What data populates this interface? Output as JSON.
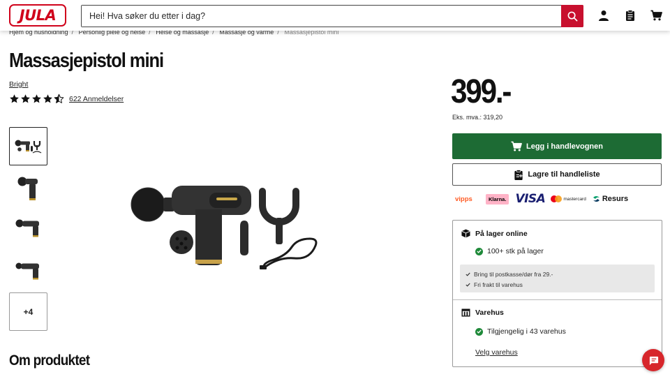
{
  "header": {
    "logo_text": "JULA",
    "search_placeholder": "Hei! Hva søker du etter i dag?",
    "icons": [
      "search-icon",
      "user-icon",
      "clipboard-list-icon",
      "shopping-cart-icon"
    ]
  },
  "breadcrumb": [
    "Hjem og husholdning",
    "Personlig pleie og helse",
    "Helse og massasje",
    "Massasje og varme",
    "Massasjepistol mini"
  ],
  "product": {
    "title": "Massasjepistol mini",
    "brand": "Bright",
    "rating": 4.5,
    "reviews_label": "622 Anmeldelser",
    "more_images_label": "+4"
  },
  "sections": {
    "about_title": "Om produktet"
  },
  "purchase": {
    "price": "399.-",
    "ex_vat": "Eks. mva.: 319,20",
    "add_to_cart_label": "Legg i handlevognen",
    "save_list_label": "Lagre til handleliste"
  },
  "payments": {
    "vipps": "vipps",
    "klarna": "Klarna.",
    "visa": "VISA",
    "mastercard": "mastercard",
    "resurs": "Resurs"
  },
  "stock": {
    "online_title": "På lager online",
    "online_status": "100+ stk på lager",
    "shipping": [
      "Bring til postkasse/dør fra 29.-",
      "Fri frakt til varehus"
    ],
    "store_title": "Varehus",
    "store_status": "Tilgjengelig i 43 varehus",
    "store_link": "Velg varehus"
  },
  "colors": {
    "brand_red": "#d0021b",
    "cart_green": "#1d6b34",
    "stock_green": "#1f8a3a"
  }
}
